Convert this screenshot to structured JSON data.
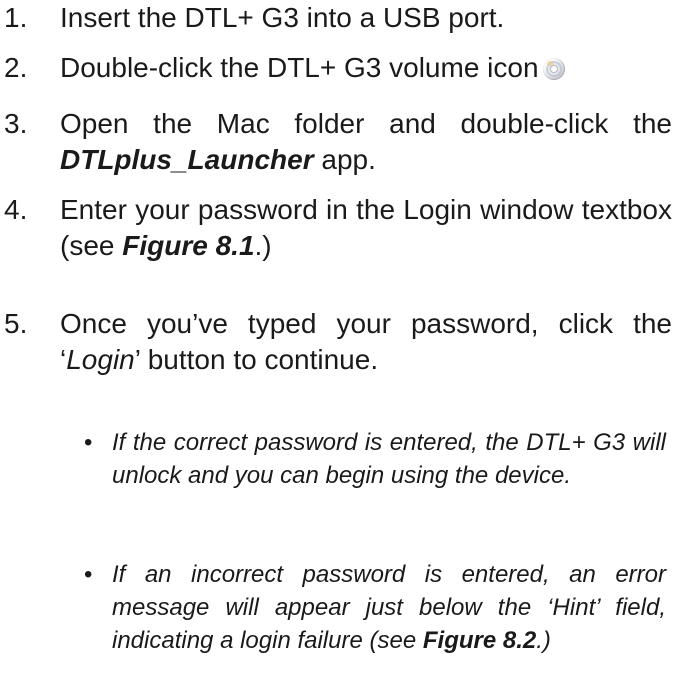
{
  "steps": [
    {
      "number": "1.",
      "text": "Insert the DTL+ G3 into a USB port."
    },
    {
      "number": "2.",
      "text": "Double-click the DTL+ G3 volume icon",
      "icon": "disc-volume-icon"
    },
    {
      "number": "3.",
      "text_before": "Open the Mac folder and double-click the ",
      "emphasis": "DTLplus_Launcher",
      "text_after": " app."
    },
    {
      "number": "4.",
      "text_before": "Enter your password in the Login window textbox (see ",
      "emphasis": "Figure 8.1",
      "text_after": ".)"
    },
    {
      "number": "5.",
      "text_before": "Once you’ve typed your password, click the ‘",
      "emphasis": "Login",
      "text_after": "’ button to continue."
    }
  ],
  "bullets": [
    {
      "marker": "•",
      "text": "If the correct password is entered, the DTL+ G3 will unlock and you can begin using the device."
    },
    {
      "marker": "•",
      "text_before": "If an incorrect password is entered, an error message will appear just below the ‘Hint’ field, indicating a login failure (see ",
      "emphasis": "Figure 8.2",
      "text_after": ".)"
    }
  ]
}
